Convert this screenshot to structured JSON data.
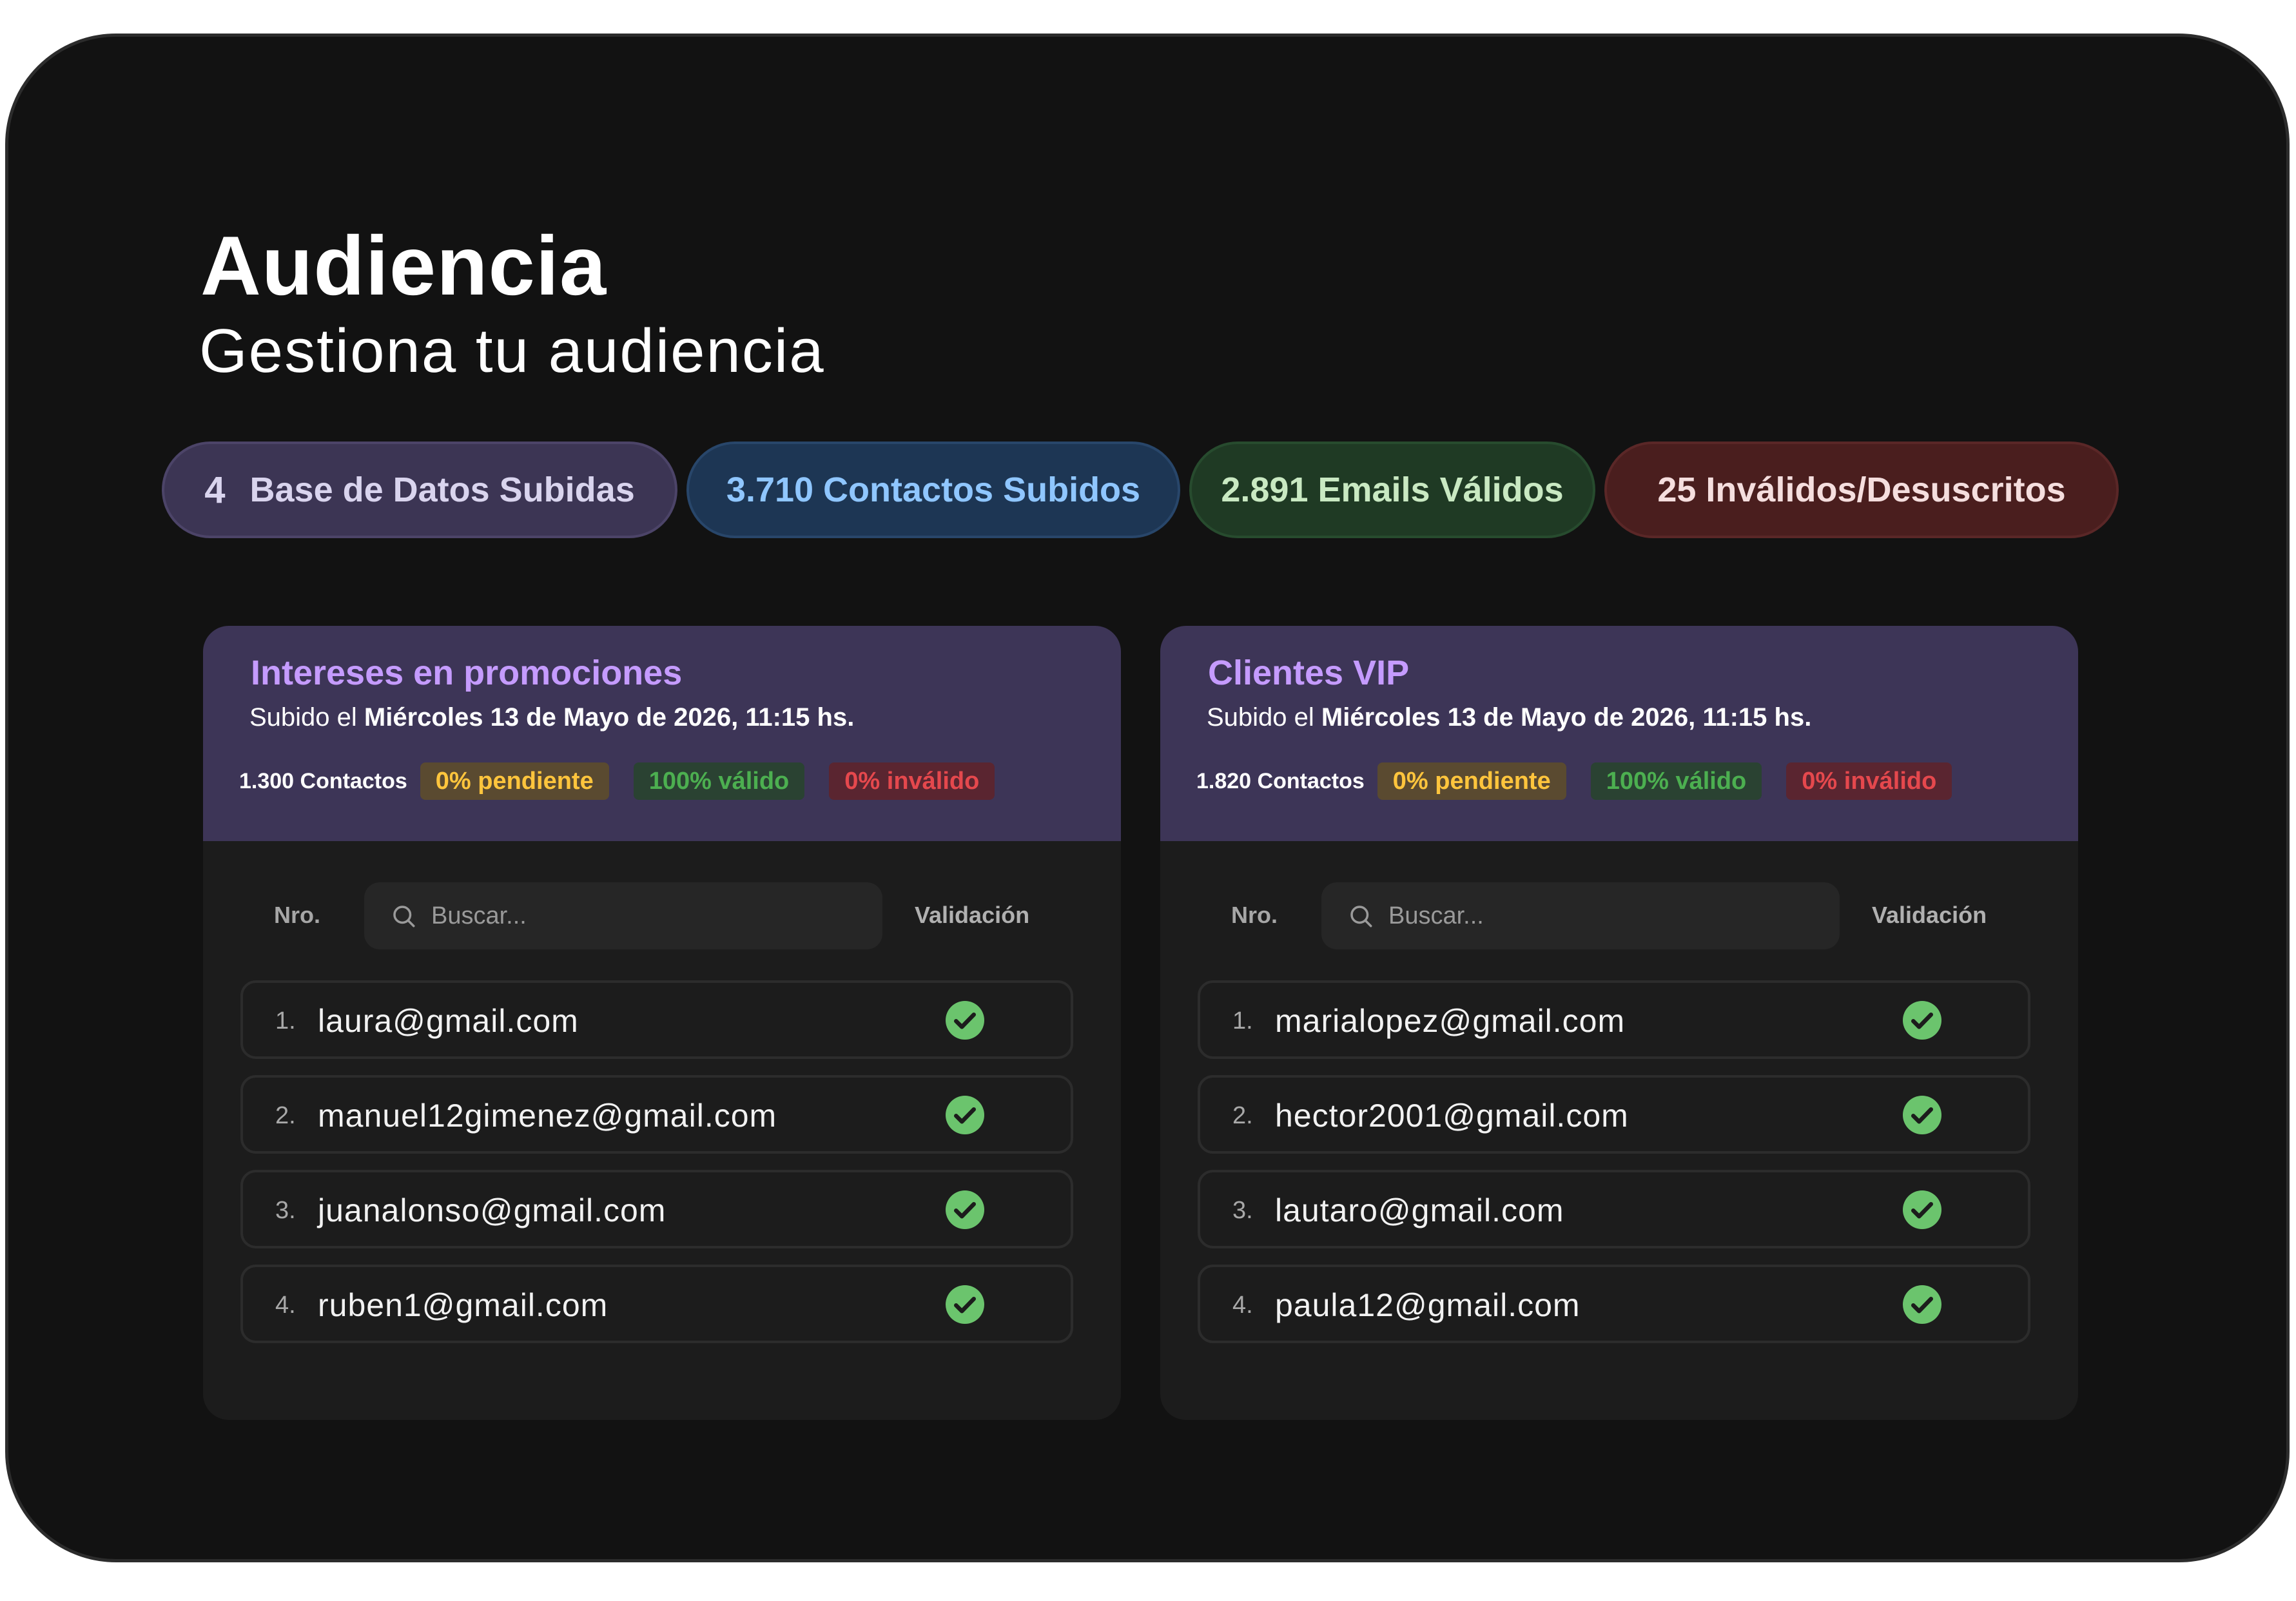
{
  "header": {
    "title": "Audiencia",
    "subtitle": "Gestiona tu audiencia"
  },
  "summary": {
    "databases": {
      "count": "4",
      "label": "Base de Datos Subidas"
    },
    "contacts": "3.710 Contactos Subidos",
    "valid": "2.891 Emails Válidos",
    "invalid": "25 Inválidos/Desuscritos"
  },
  "colors": {
    "accent_purple": "#c59bff",
    "valid_green": "#6bc46d",
    "pending_yellow": "#ffc53d",
    "invalid_red": "#e5484d"
  },
  "lists": [
    {
      "title": "Intereses en promociones",
      "uploaded_prefix": "Subido el",
      "uploaded_date": "Miércoles 13 de Mayo de 2026, 11:15 hs.",
      "contacts": "1.300 Contactos",
      "pending": "0% pendiente",
      "valid": "100% válido",
      "invalid": "0% inválido",
      "table": {
        "col_number": "Nro.",
        "search_placeholder": "Buscar...",
        "col_validation": "Validación"
      },
      "rows": [
        {
          "number": "1.",
          "email": "laura@gmail.com",
          "status_icon": "check-circle-icon"
        },
        {
          "number": "2.",
          "email": "manuel12gimenez@gmail.com",
          "status_icon": "check-circle-icon"
        },
        {
          "number": "3.",
          "email": "juanalonso@gmail.com",
          "status_icon": "check-circle-icon"
        },
        {
          "number": "4.",
          "email": "ruben1@gmail.com",
          "status_icon": "check-circle-icon"
        }
      ]
    },
    {
      "title": "Clientes VIP",
      "uploaded_prefix": "Subido el",
      "uploaded_date": "Miércoles 13 de Mayo de 2026, 11:15 hs.",
      "contacts": "1.820 Contactos",
      "pending": "0% pendiente",
      "valid": "100% válido",
      "invalid": "0% inválido",
      "table": {
        "col_number": "Nro.",
        "search_placeholder": "Buscar...",
        "col_validation": "Validación"
      },
      "rows": [
        {
          "number": "1.",
          "email": "marialopez@gmail.com",
          "status_icon": "check-circle-icon"
        },
        {
          "number": "2.",
          "email": "hector2001@gmail.com",
          "status_icon": "check-circle-icon"
        },
        {
          "number": "3.",
          "email": "lautaro@gmail.com",
          "status_icon": "check-circle-icon"
        },
        {
          "number": "4.",
          "email": "paula12@gmail.com",
          "status_icon": "check-circle-icon"
        }
      ]
    }
  ]
}
